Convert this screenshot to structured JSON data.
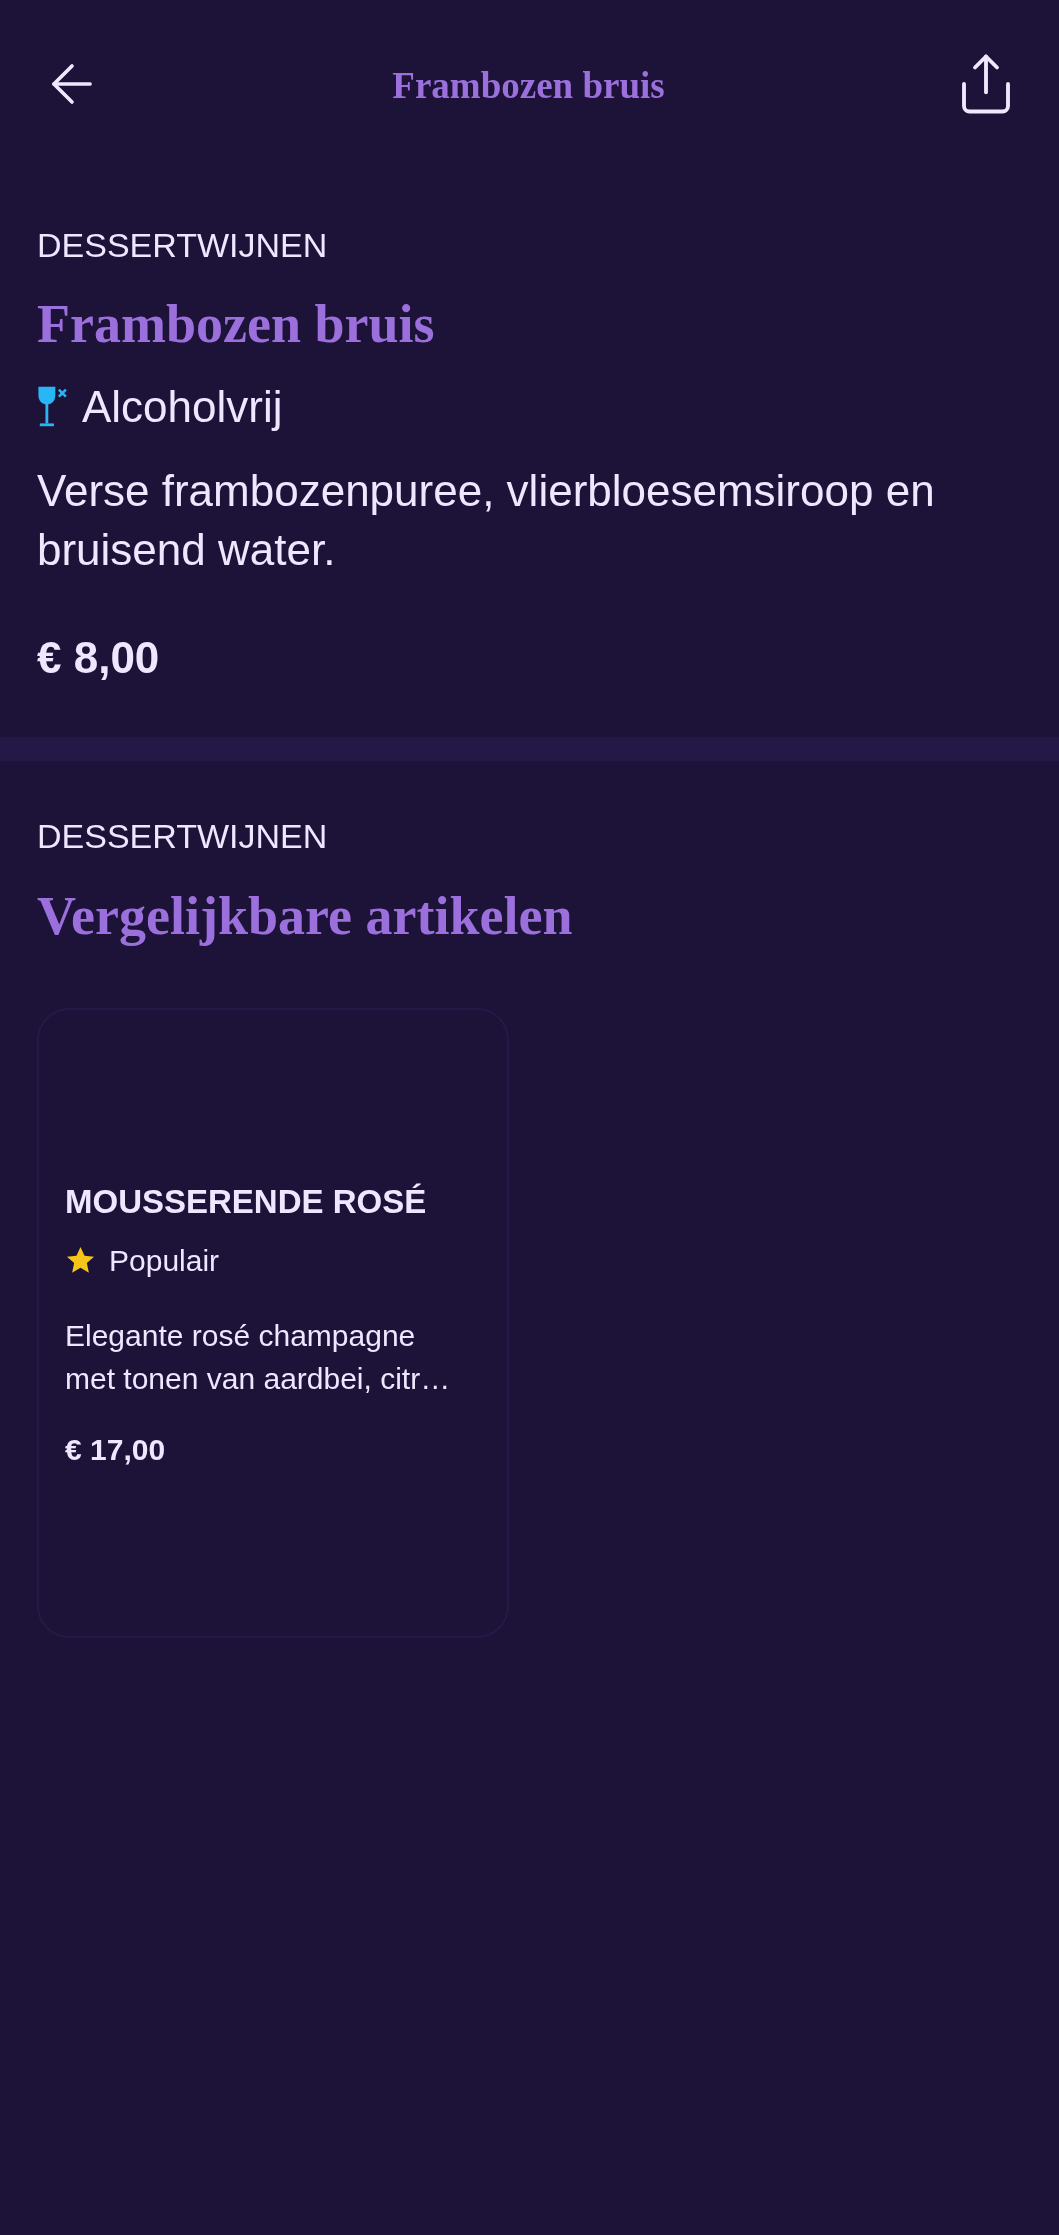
{
  "header": {
    "title": "Frambozen bruis"
  },
  "product": {
    "category": "DESSERTWIJNEN",
    "name": "Frambozen bruis",
    "badge": {
      "kind": "alcohol_free",
      "label": "Alcoholvrij"
    },
    "description": "Verse frambozenpuree, vlierbloesemsiroop en bruisend water.",
    "price": "€ 8,00"
  },
  "similar": {
    "category": "DESSERTWIJNEN",
    "heading": "Vergelijkbare artikelen",
    "items": [
      {
        "name": "MOUSSERENDE ROSÉ",
        "tag": {
          "kind": "popular",
          "label": "Populair"
        },
        "description": "Elegante rosé champagne met tonen van aardbei, citr…",
        "price": "€ 17,00"
      }
    ]
  }
}
